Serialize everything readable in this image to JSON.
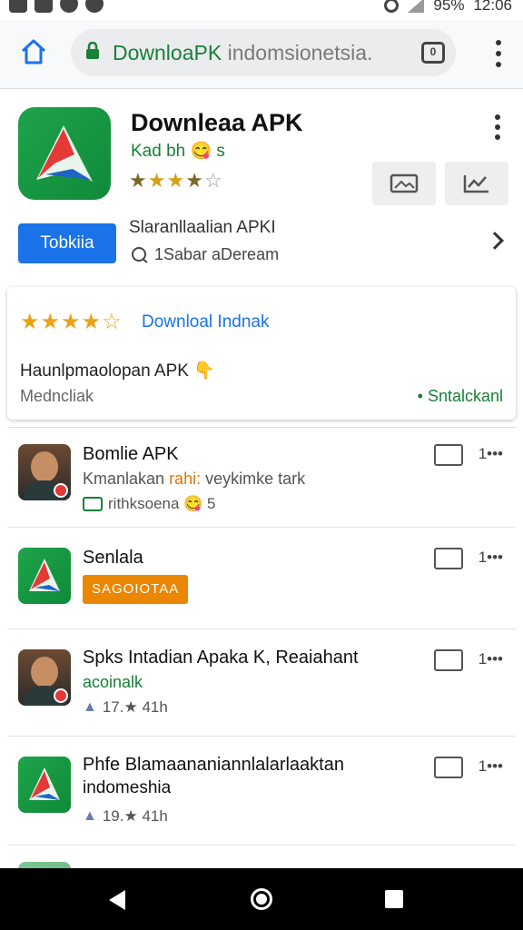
{
  "status": {
    "battery": "95%",
    "time": "12:06"
  },
  "browser": {
    "url_host": "DownloaPK",
    "url_rest": "indomsionetsia.",
    "tabs_count": "0"
  },
  "app": {
    "title": "Downleaa APK",
    "developer": "Kad bh 😋 s",
    "rating_stars": 3.5,
    "install_label": "Tobkiia",
    "subtitle": "Slaranllaalian APKI",
    "subtitle2": "1Sabar aDeream"
  },
  "review": {
    "stars": "★★★★☆",
    "link": "Downloal Indnak",
    "text": "Haunlpmaolopan APK 👇",
    "sub": "Medncliak",
    "action": "• Sntalckanl"
  },
  "list": [
    {
      "thumb": "person",
      "title": "Bomlie APK",
      "line_pre": "Kmanlakan ",
      "line_hl": "rahi:",
      "line_post": " veykimke tark",
      "meta": "rithksoena 😋 5",
      "meta_kind": "green",
      "count": "1•••"
    },
    {
      "thumb": "app",
      "title": "Senlala",
      "tag": "SAGOIOTAA",
      "count": "1•••"
    },
    {
      "thumb": "person",
      "title": "Spks Intadian Apaka K, Reaiahant",
      "line_pre": "acoinalk",
      "line_hl": "",
      "line_post": "",
      "meta": "17.★ 41h",
      "meta_kind": "thumb",
      "count": "1•••"
    },
    {
      "thumb": "app",
      "title": "Phfe Blamaananiannlalarlaaktan",
      "title2": "indomeshia",
      "meta": "19.★ 41h",
      "meta_kind": "thumb",
      "count": "1•••"
    }
  ]
}
